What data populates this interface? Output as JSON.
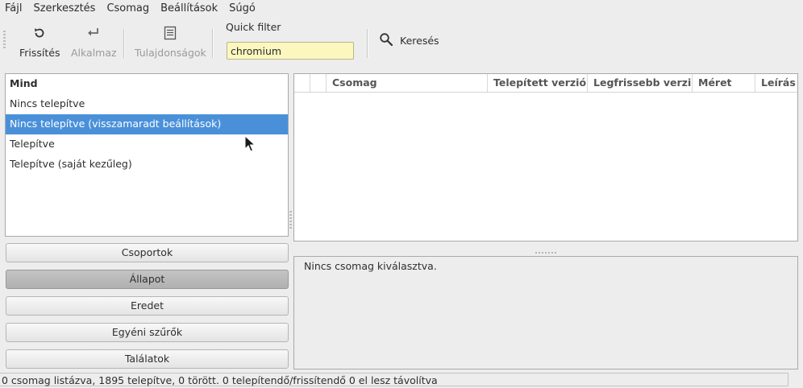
{
  "menu": [
    "Fájl",
    "Szerkesztés",
    "Csomag",
    "Beállítások",
    "Súgó"
  ],
  "toolbar": {
    "refresh_label": "Frissítés",
    "refresh_icon": "refresh-icon",
    "apply_label": "Alkalmaz",
    "apply_icon": "apply-icon",
    "properties_label": "Tulajdonságok",
    "properties_icon": "properties-icon",
    "quick_filter_label": "Quick filter",
    "quick_filter_value": "chromium",
    "search_label": "Keresés",
    "search_icon": "search-icon"
  },
  "filters": [
    {
      "label": "Mind"
    },
    {
      "label": "Nincs telepítve"
    },
    {
      "label": "Nincs telepítve (visszamaradt beállítások)"
    },
    {
      "label": "Telepítve"
    },
    {
      "label": "Telepítve (saját kezűleg)"
    }
  ],
  "categories": [
    "Csoportok",
    "Állapot",
    "Eredet",
    "Egyéni szűrők",
    "Találatok"
  ],
  "table": {
    "columns": [
      "",
      "",
      "Csomag",
      "Telepített verzió",
      "Legfrissebb verzi",
      "Méret",
      "Leírás"
    ]
  },
  "details_text": "Nincs csomag kiválasztva.",
  "status": "0 csomag listázva, 1895 telepítve, 0 törött. 0 telepítendő/frissítendő 0 el lesz távolítva",
  "colors": {
    "selection": "#4a90d9",
    "quick_filter_bg": "#fbf7bf"
  }
}
